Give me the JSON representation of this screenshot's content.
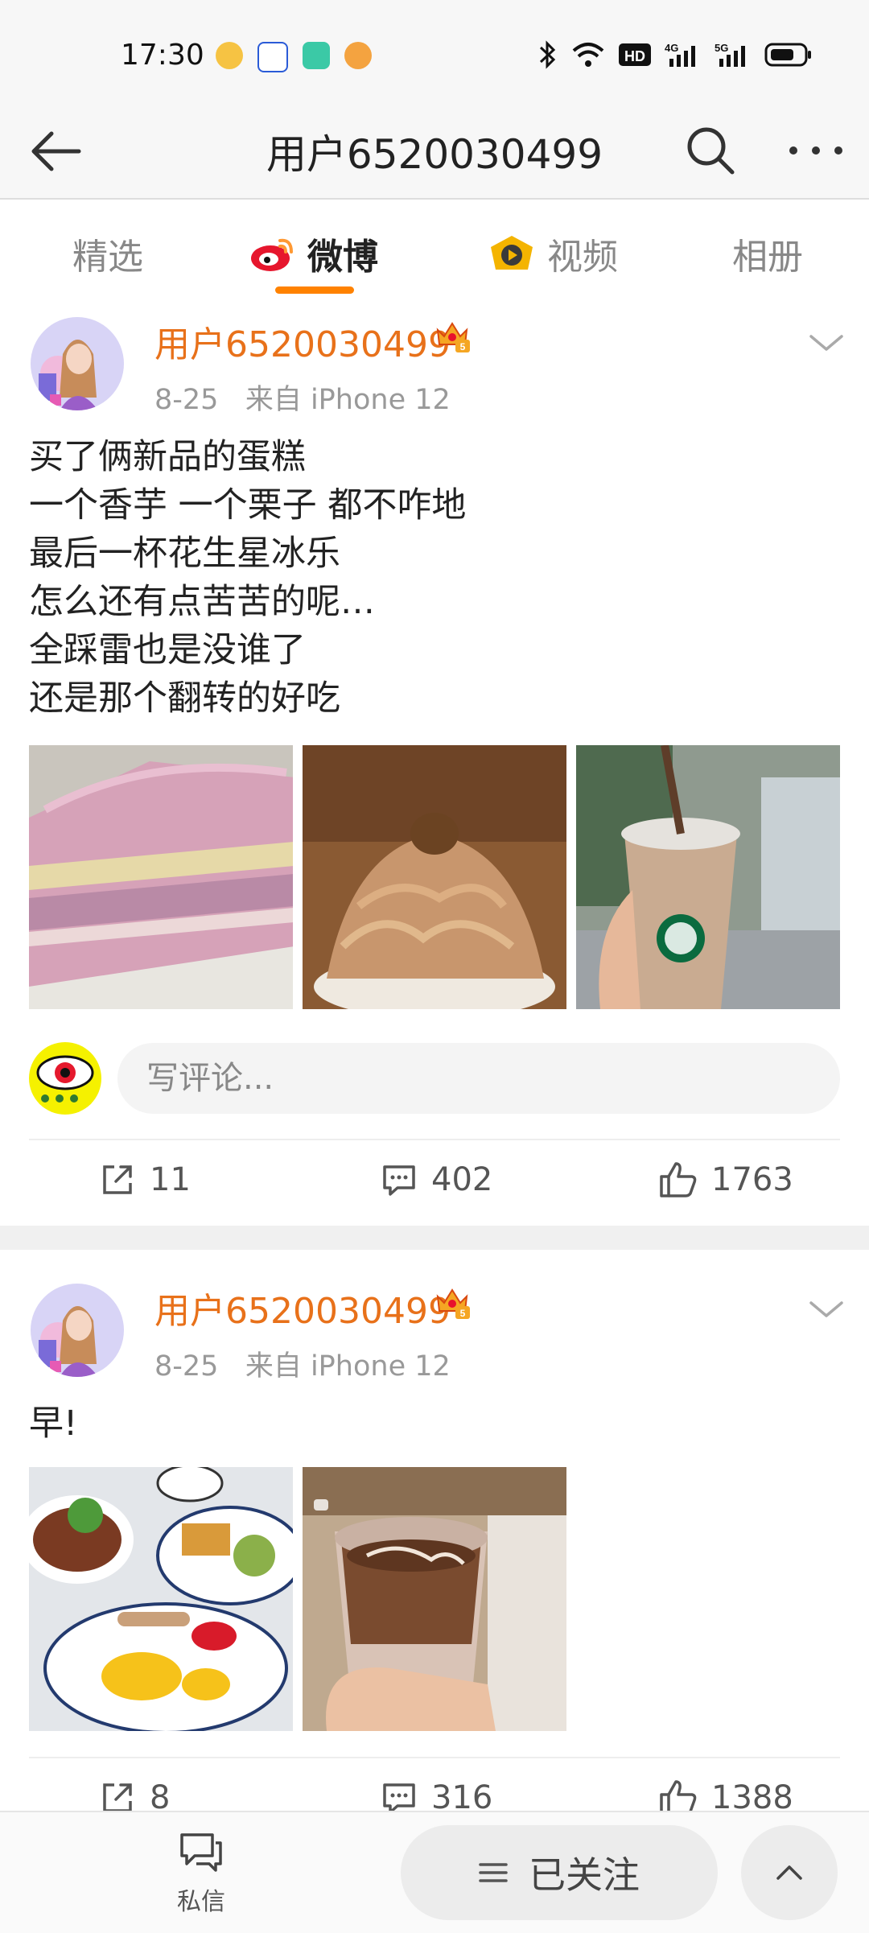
{
  "status_bar": {
    "time": "17:30",
    "network": "5G"
  },
  "header": {
    "title": "用户6520030499"
  },
  "tabs": [
    {
      "label": "精选",
      "active": false
    },
    {
      "label": "微博",
      "active": true
    },
    {
      "label": "视频",
      "active": false
    },
    {
      "label": "相册",
      "active": false
    }
  ],
  "posts": [
    {
      "username": "用户6520030499",
      "date": "8-25",
      "source": "来自 iPhone 12",
      "text": "买了俩新品的蛋糕\n一个香芋 一个栗子 都不咋地\n最后一杯花生星冰乐\n怎么还有点苦苦的呢…\n全踩雷也是没谁了\n还是那个翻转的好吃",
      "comment_placeholder": "写评论...",
      "reposts": "11",
      "comments": "402",
      "likes": "1763"
    },
    {
      "username": "用户6520030499",
      "date": "8-25",
      "source": "来自 iPhone 12",
      "text": "早!",
      "reposts": "8",
      "comments": "316",
      "likes": "1388"
    }
  ],
  "bottom_bar": {
    "dm_label": "私信",
    "follow_label": "已关注"
  },
  "colors": {
    "accent": "#ff8200",
    "username": "#e8711a"
  }
}
